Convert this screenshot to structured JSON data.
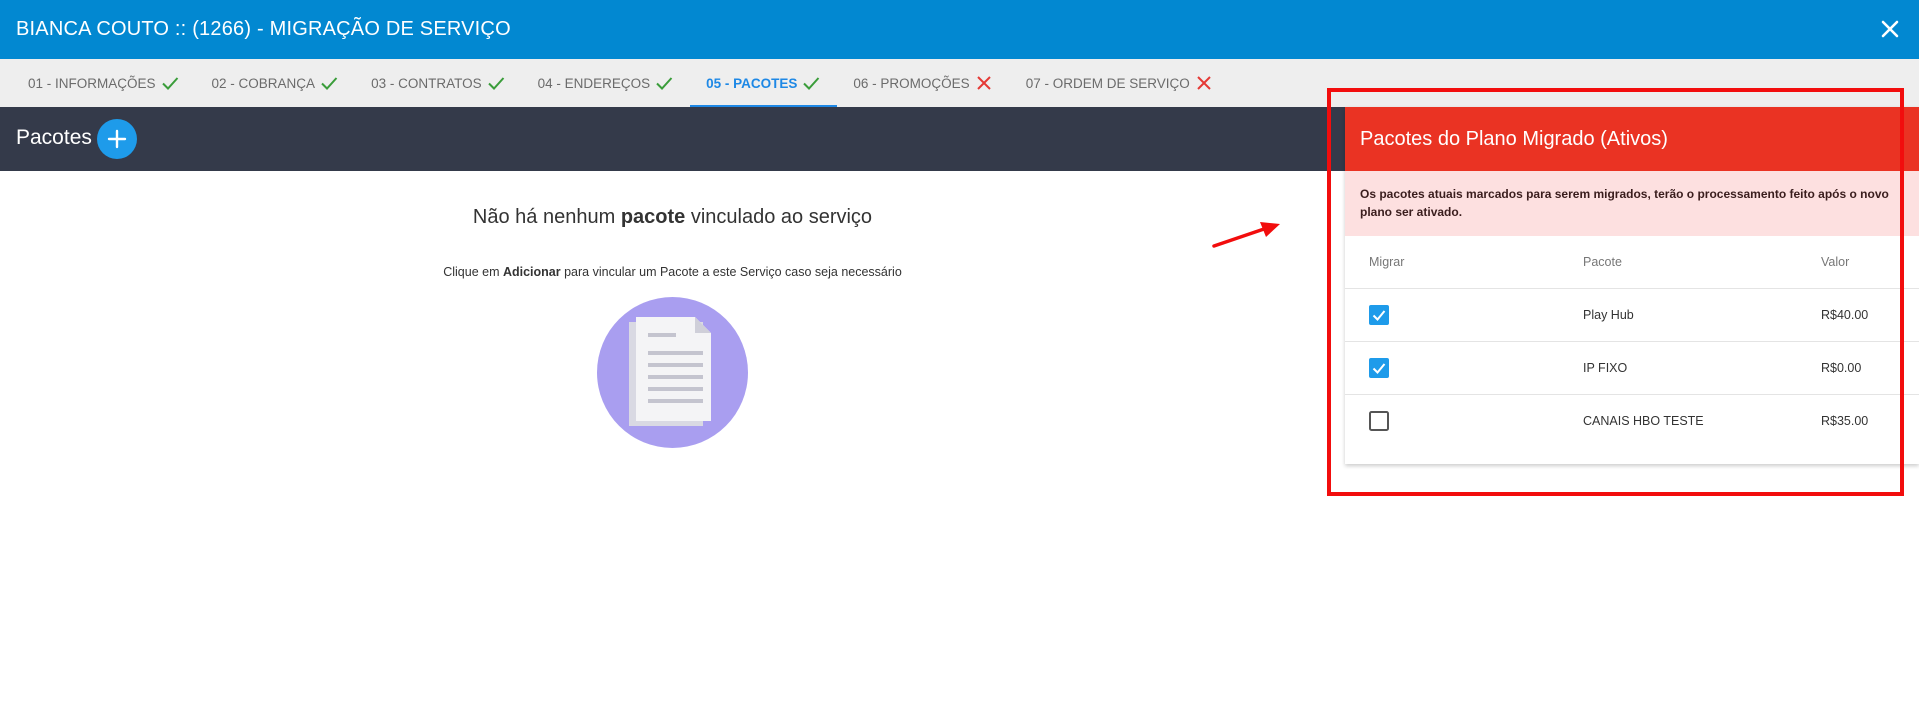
{
  "window": {
    "title": "BIANCA COUTO :: (1266) - MIGRAÇÃO DE SERVIÇO"
  },
  "tabs": [
    {
      "label": "01 - INFORMAÇÕES",
      "status": "ok"
    },
    {
      "label": "02 - COBRANÇA",
      "status": "ok"
    },
    {
      "label": "03 - CONTRATOS",
      "status": "ok"
    },
    {
      "label": "04 - ENDEREÇOS",
      "status": "ok"
    },
    {
      "label": "05 - PACOTES",
      "status": "ok",
      "active": true
    },
    {
      "label": "06 - PROMOÇÕES",
      "status": "error"
    },
    {
      "label": "07 - ORDEM DE SERVIÇO",
      "status": "error"
    }
  ],
  "toolbar": {
    "label": "Pacotes",
    "add_icon": "plus-icon"
  },
  "empty": {
    "title_pre": "Não há nenhum ",
    "title_bold": "pacote",
    "title_post": " vinculado ao serviço",
    "sub_pre": "Clique em ",
    "sub_bold": "Adicionar",
    "sub_post": " para vincular um Pacote a este Serviço caso seja necessário"
  },
  "panel": {
    "title": "Pacotes do Plano Migrado (Ativos)",
    "note": "Os pacotes atuais marcados para serem migrados, terão o processamento feito após o novo plano ser ativado.",
    "columns": {
      "migrar": "Migrar",
      "pacote": "Pacote",
      "valor": "Valor"
    },
    "rows": [
      {
        "checked": true,
        "pacote": "Play Hub",
        "valor": "R$40.00"
      },
      {
        "checked": true,
        "pacote": "IP FIXO",
        "valor": "R$0.00"
      },
      {
        "checked": false,
        "pacote": "CANAIS HBO TESTE",
        "valor": "R$35.00"
      }
    ]
  },
  "colors": {
    "titlebar": "#0288d1",
    "active_tab": "#1e88e5",
    "check_ok": "#3a9d3a",
    "check_error": "#e53935",
    "dark_bar": "#343a4a",
    "panel_header": "#ea3323",
    "panel_note_bg": "#fde0e0",
    "annotation_red": "#f20d0d",
    "illustration": "#a99ef0"
  }
}
